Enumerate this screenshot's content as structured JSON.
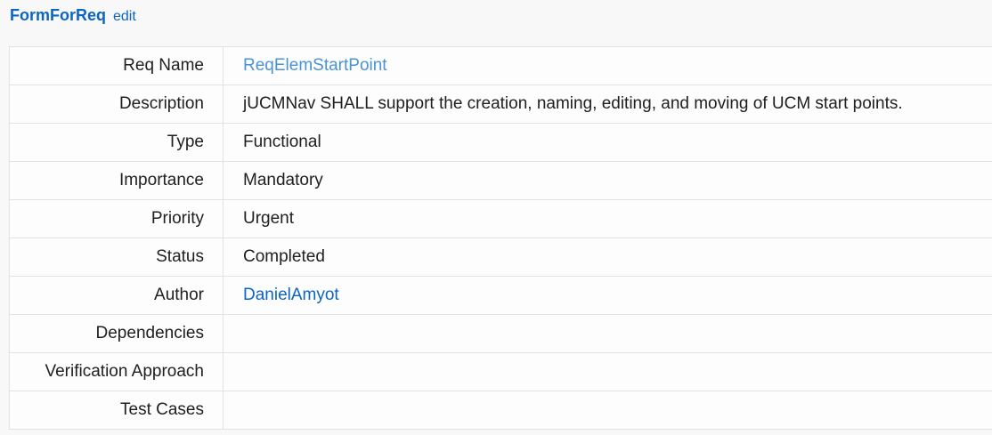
{
  "header": {
    "title": "FormForReq",
    "edit_label": "edit"
  },
  "fields": {
    "req_name": {
      "label": "Req Name",
      "value": "ReqElemStartPoint"
    },
    "description": {
      "label": "Description",
      "value": "jUCMNav SHALL support the creation, naming, editing, and moving of UCM start points."
    },
    "type": {
      "label": "Type",
      "value": "Functional"
    },
    "importance": {
      "label": "Importance",
      "value": "Mandatory"
    },
    "priority": {
      "label": "Priority",
      "value": "Urgent"
    },
    "status": {
      "label": "Status",
      "value": "Completed"
    },
    "author": {
      "label": "Author",
      "value": "DanielAmyot"
    },
    "dependencies": {
      "label": "Dependencies",
      "value": ""
    },
    "verification_approach": {
      "label": "Verification Approach",
      "value": ""
    },
    "test_cases": {
      "label": "Test Cases",
      "value": ""
    }
  },
  "colors": {
    "link": "#0b65c2",
    "link_light": "#4a93d6",
    "text": "#202020",
    "border": "#e2e2e2"
  }
}
